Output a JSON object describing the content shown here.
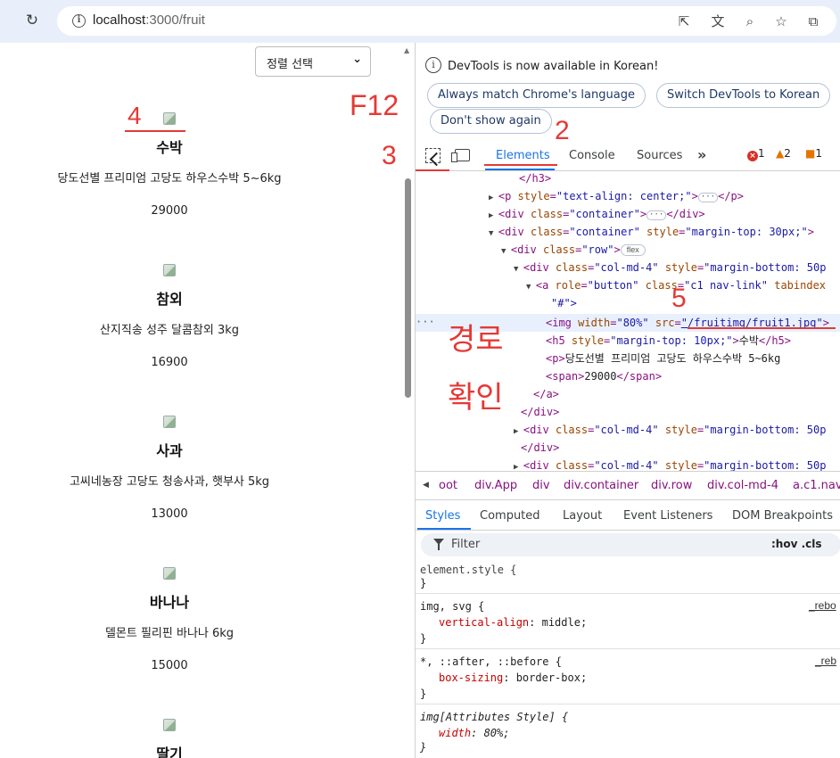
{
  "browser": {
    "url_host": "localhost",
    "url_path": ":3000/fruit"
  },
  "page": {
    "sort_select": "정렬 선택",
    "fruits": [
      {
        "name": "수박",
        "desc": "당도선별 프리미엄 고당도 하우스수박 5~6kg",
        "price": "29000"
      },
      {
        "name": "참외",
        "desc": "산지직송 성주 달콤참외 3kg",
        "price": "16900"
      },
      {
        "name": "사과",
        "desc": "고씨네농장 고당도 청송사과, 햇부사 5kg",
        "price": "13000"
      },
      {
        "name": "바나나",
        "desc": "델몬트 필리핀 바나나 6kg",
        "price": "15000"
      },
      {
        "name": "딸기",
        "desc": "",
        "price": ""
      }
    ]
  },
  "devtools": {
    "info_message": "DevTools is now available in Korean!",
    "btn_match": "Always match Chrome's language",
    "btn_switch": "Switch DevTools to Korean",
    "btn_dont_show": "Don't show again",
    "tabs": {
      "elements": "Elements",
      "console": "Console",
      "sources": "Sources",
      "more": "»"
    },
    "badges": {
      "errors": "1",
      "warnings": "2",
      "issues": "1"
    },
    "dom": {
      "l0": "</h3>",
      "l1_tag": "<p ",
      "l1_an": "style",
      "l1_av": "\"text-align: center;\"",
      "l1_end": "</p>",
      "l2_tag": "<div ",
      "l2_an": "class",
      "l2_av": "\"container\"",
      "l2_end": "</div>",
      "l3_tag": "<div ",
      "l3_an": "class",
      "l3_av": "\"container\"",
      "l3_an2": "style",
      "l3_av2": "\"margin-top: 30px;\"",
      "l4_tag": "<div ",
      "l4_an": "class",
      "l4_av": "\"row\"",
      "l4_badge": "flex",
      "l5_tag": "<div ",
      "l5_an": "class",
      "l5_av": "\"col-md-4\"",
      "l5_an2": "style",
      "l5_av2": "\"margin-bottom: 50p",
      "l6_tag": "<a ",
      "l6_an": "role",
      "l6_av": "\"button\"",
      "l6_an2": "class",
      "l6_av2": "\"c1 nav-link\"",
      "l6_an3": "tabindex",
      "l7": "\"#\">",
      "l8_tag": "<img ",
      "l8_an": "width",
      "l8_av": "\"80%\"",
      "l8_an2": "src",
      "l8_av2": "\"/fruitimg/fruit1.jpg\"",
      "l9_tag": "<h5 ",
      "l9_an": "style",
      "l9_av": "\"margin-top: 10px;\"",
      "l9_tx": "수박",
      "l9_end": "</h5>",
      "l10_tag": "<p>",
      "l10_tx": "당도선별 프리미엄 고당도 하우스수박 5~6kg",
      "l11_tag": "<span>",
      "l11_tx": "29000",
      "l11_end": "</span>",
      "l12": "</a>",
      "l13": "</div>",
      "l14_tag": "<div ",
      "l14_an": "class",
      "l14_av": "\"col-md-4\"",
      "l14_an2": "style",
      "l14_av2": "\"margin-bottom: 50p",
      "l15": "</div>",
      "l16_tag": "<div ",
      "l16_an": "class",
      "l16_av": "\"col-md-4\"",
      "l16_an2": "style",
      "l16_av2": "\"margin-bottom: 50p"
    },
    "crumbs": [
      "oot",
      "div.App",
      "div",
      "div.container",
      "div.row",
      "div.col-md-4",
      "a.c1.nav"
    ],
    "style_tabs": [
      "Styles",
      "Computed",
      "Layout",
      "Event Listeners",
      "DOM Breakpoints"
    ],
    "filter_placeholder": "Filter",
    "hov_cls": ":hov .cls",
    "rules": {
      "r1_sel": "element.style {",
      "r1_close": "}",
      "r2_sel": "img, svg {",
      "r2_prop": "vertical-align",
      "r2_val": ": middle;",
      "r2_close": "}",
      "r2_src": "_rebo",
      "r3_sel": "*, ::after, ::before {",
      "r3_prop": "box-sizing",
      "r3_val": ": border-box;",
      "r3_close": "}",
      "r3_src": "_reb",
      "r4_sel": "img[Attributes Style] {",
      "r4_prop": "width",
      "r4_val": ": 80%;",
      "r4_close": "}"
    }
  },
  "annotations": {
    "a4": "4",
    "f12": "F12",
    "a2": "2",
    "a3": "3",
    "a5": "5",
    "path": "경로",
    "check": "확인"
  }
}
